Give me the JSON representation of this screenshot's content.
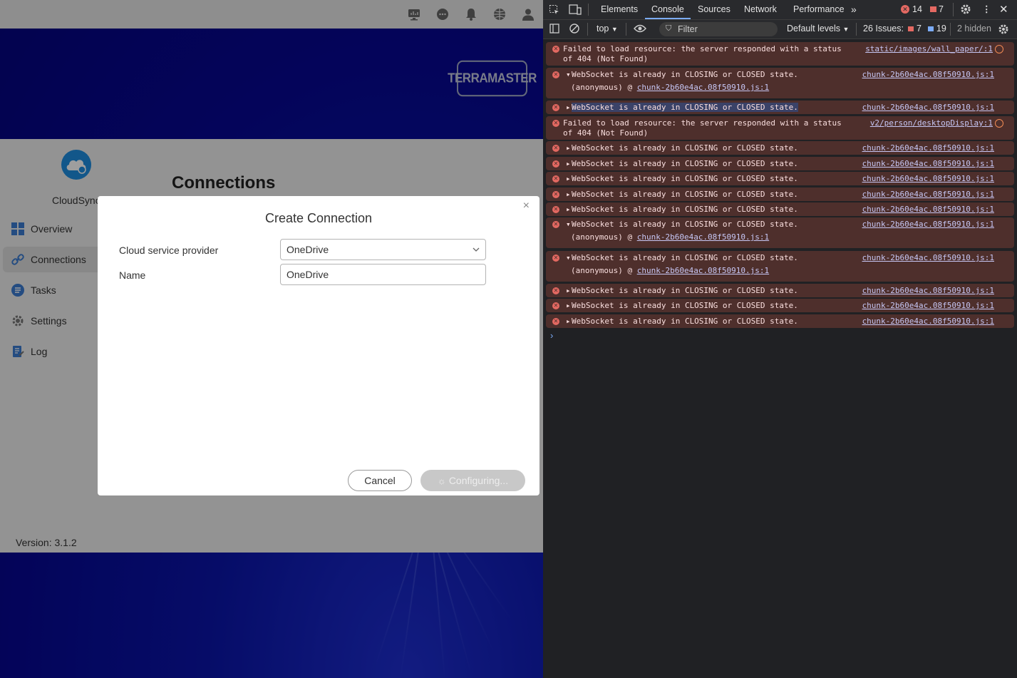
{
  "app": {
    "logo_text": "TERRAMASTER",
    "app_name": "CloudSync",
    "page_title": "Connections",
    "version": "Version: 3.1.2",
    "nav": [
      {
        "label": "Overview",
        "icon": "overview-icon",
        "active": false
      },
      {
        "label": "Connections",
        "icon": "link-icon",
        "active": true
      },
      {
        "label": "Tasks",
        "icon": "tasks-icon",
        "active": false
      },
      {
        "label": "Settings",
        "icon": "gear-icon",
        "active": false
      },
      {
        "label": "Log",
        "icon": "log-icon",
        "active": false
      }
    ],
    "topbar_icons": [
      "monitor-icon",
      "chat-icon",
      "bell-icon",
      "globe-icon",
      "user-icon"
    ]
  },
  "modal": {
    "title": "Create Connection",
    "provider_label": "Cloud service provider",
    "provider_value": "OneDrive",
    "name_label": "Name",
    "name_value": "OneDrive",
    "cancel": "Cancel",
    "configuring": "Configuring..."
  },
  "devtools": {
    "tabs": [
      "Elements",
      "Console",
      "Sources",
      "Network",
      "Performance"
    ],
    "active_tab": "Console",
    "error_count": "14",
    "issue_count": "7",
    "context": "top",
    "filter_placeholder": "Filter",
    "levels": "Default levels",
    "issues_label": "26 Issues:",
    "issues_errors": "7",
    "issues_info": "19",
    "hidden": "2 hidden",
    "messages": [
      {
        "text": "Failed to load resource: the server responded with a status\nof 404 (Not Found)",
        "src": "static/images/wall_paper/:1",
        "expandable": false,
        "expanded": false,
        "network": true
      },
      {
        "text": "WebSocket is already in CLOSING or CLOSED state.",
        "src": "chunk-2b60e4ac.08f50910.js:1",
        "expandable": true,
        "expanded": true,
        "sub_prefix": "(anonymous) @ ",
        "sub_link": "chunk-2b60e4ac.08f50910.js:1"
      },
      {
        "text": "WebSocket is already in CLOSING or CLOSED state.",
        "src": "chunk-2b60e4ac.08f50910.js:1",
        "expandable": true,
        "expanded": false,
        "highlight": true
      },
      {
        "text": "Failed to load resource: the server responded with a status\nof 404 (Not Found)",
        "src": "v2/person/desktopDisplay:1",
        "expandable": false,
        "expanded": false,
        "network": true
      },
      {
        "text": "WebSocket is already in CLOSING or CLOSED state.",
        "src": "chunk-2b60e4ac.08f50910.js:1",
        "expandable": true,
        "expanded": false
      },
      {
        "text": "WebSocket is already in CLOSING or CLOSED state.",
        "src": "chunk-2b60e4ac.08f50910.js:1",
        "expandable": true,
        "expanded": false
      },
      {
        "text": "WebSocket is already in CLOSING or CLOSED state.",
        "src": "chunk-2b60e4ac.08f50910.js:1",
        "expandable": true,
        "expanded": false
      },
      {
        "text": "WebSocket is already in CLOSING or CLOSED state.",
        "src": "chunk-2b60e4ac.08f50910.js:1",
        "expandable": true,
        "expanded": false
      },
      {
        "text": "WebSocket is already in CLOSING or CLOSED state.",
        "src": "chunk-2b60e4ac.08f50910.js:1",
        "expandable": true,
        "expanded": false
      },
      {
        "text": "WebSocket is already in CLOSING or CLOSED state.",
        "src": "chunk-2b60e4ac.08f50910.js:1",
        "expandable": true,
        "expanded": true,
        "sub_prefix": "(anonymous) @ ",
        "sub_link": "chunk-2b60e4ac.08f50910.js:1"
      },
      {
        "text": "WebSocket is already in CLOSING or CLOSED state.",
        "src": "chunk-2b60e4ac.08f50910.js:1",
        "expandable": true,
        "expanded": true,
        "sub_prefix": "(anonymous) @ ",
        "sub_link": "chunk-2b60e4ac.08f50910.js:1"
      },
      {
        "text": "WebSocket is already in CLOSING or CLOSED state.",
        "src": "chunk-2b60e4ac.08f50910.js:1",
        "expandable": true,
        "expanded": false
      },
      {
        "text": "WebSocket is already in CLOSING or CLOSED state.",
        "src": "chunk-2b60e4ac.08f50910.js:1",
        "expandable": true,
        "expanded": false
      },
      {
        "text": "WebSocket is already in CLOSING or CLOSED state.",
        "src": "chunk-2b60e4ac.08f50910.js:1",
        "expandable": true,
        "expanded": false
      }
    ],
    "prompt": "›"
  }
}
